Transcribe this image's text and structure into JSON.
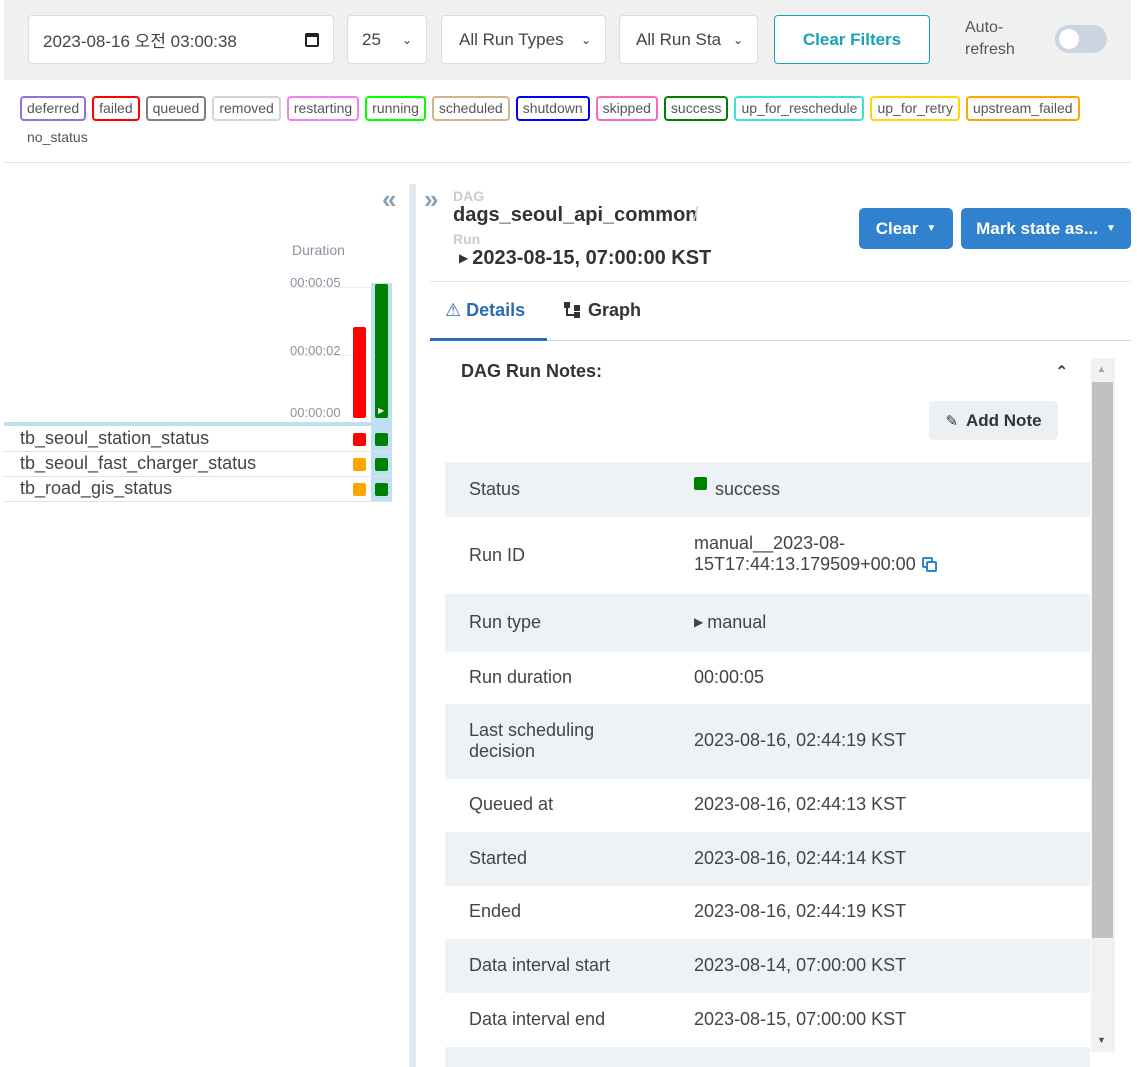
{
  "filters": {
    "date_value": "2023-08-16 오전 03:00:38",
    "page_size": "25",
    "run_types": "All Run Types",
    "run_states": "All Run Sta",
    "clear_filters": "Clear Filters",
    "auto_refresh": "Auto-refresh",
    "auto_refresh_on": false
  },
  "legend": [
    {
      "label": "deferred",
      "color": "#9370db"
    },
    {
      "label": "failed",
      "color": "#ff0000"
    },
    {
      "label": "queued",
      "color": "#808080"
    },
    {
      "label": "removed",
      "color": "#d3d3d3"
    },
    {
      "label": "restarting",
      "color": "#ee82ee"
    },
    {
      "label": "running",
      "color": "#00ff00"
    },
    {
      "label": "scheduled",
      "color": "#d2b48c"
    },
    {
      "label": "shutdown",
      "color": "#0000ff"
    },
    {
      "label": "skipped",
      "color": "#ff69b4"
    },
    {
      "label": "success",
      "color": "#008000"
    },
    {
      "label": "up_for_reschedule",
      "color": "#40e0d0"
    },
    {
      "label": "up_for_retry",
      "color": "#ffd700"
    },
    {
      "label": "upstream_failed",
      "color": "#ffa500"
    },
    {
      "label": "no_status",
      "color": "transparent"
    }
  ],
  "grid": {
    "duration_label": "Duration",
    "ticks": [
      "00:00:05",
      "00:00:02",
      "00:00:00"
    ],
    "runs": [
      {
        "duration_seconds": 3.4,
        "state": "failed",
        "color": "#ff0000"
      },
      {
        "duration_seconds": 5.0,
        "state": "success",
        "color": "#008000",
        "selected": true
      }
    ],
    "tasks": [
      {
        "name": "tb_seoul_station_status",
        "states": [
          "#ff0000",
          "#008000"
        ]
      },
      {
        "name": "tb_seoul_fast_charger_status",
        "states": [
          "#ffa500",
          "#008000"
        ]
      },
      {
        "name": "tb_road_gis_status",
        "states": [
          "#ffa500",
          "#008000"
        ]
      }
    ]
  },
  "breadcrumb": {
    "dag_label": "DAG",
    "dag_id": "dags_seoul_api_common",
    "separator": "/",
    "run_label": "Run",
    "run_value": "2023-08-15, 07:00:00 KST"
  },
  "actions": {
    "clear": "Clear",
    "mark_state": "Mark state as..."
  },
  "tabs": {
    "details": "Details",
    "graph": "Graph"
  },
  "notes": {
    "title": "DAG Run Notes:",
    "add_note": "Add Note"
  },
  "details": {
    "status_label": "Status",
    "status_value": "success",
    "status_color": "#008000",
    "run_id_label": "Run ID",
    "run_id_line1": "manual__2023-08-",
    "run_id_line2": "15T17:44:13.179509+00:00",
    "run_type_label": "Run type",
    "run_type_value": "manual",
    "run_duration_label": "Run duration",
    "run_duration_value": "00:00:05",
    "last_sched_line1": "Last scheduling",
    "last_sched_line2": "decision",
    "last_sched_value": "2023-08-16, 02:44:19 KST",
    "queued_label": "Queued at",
    "queued_value": "2023-08-16, 02:44:13 KST",
    "started_label": "Started",
    "started_value": "2023-08-16, 02:44:14 KST",
    "ended_label": "Ended",
    "ended_value": "2023-08-16, 02:44:19 KST",
    "interval_start_label": "Data interval start",
    "interval_start_value": "2023-08-14, 07:00:00 KST",
    "interval_end_label": "Data interval end",
    "interval_end_value": "2023-08-15, 07:00:00 KST"
  }
}
